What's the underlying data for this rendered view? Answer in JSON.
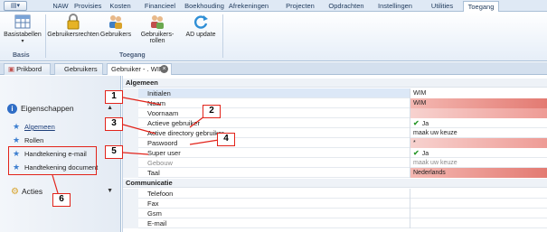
{
  "ribbon_tabs": [
    "NAW",
    "Provisies",
    "Kosten",
    "Financieel",
    "Boekhouding",
    "Afrekeningen",
    "Projecten",
    "Opdrachten",
    "Instellingen",
    "Utilities",
    "Toegang"
  ],
  "ribbon": {
    "basis_button": "Basistabellen",
    "basis_group": "Basis",
    "buttons": [
      "Gebruikersrechten",
      "Gebruikers",
      "Gebruikers-rollen",
      "AD update"
    ],
    "toegang_group": "Toegang"
  },
  "doc_tabs": [
    "Prikbord",
    "Gebruikers",
    "Gebruiker - . WIM"
  ],
  "left": {
    "eigenschappen": "Eigenschappen",
    "items": [
      "Algemeen",
      "Rollen",
      "Handtekening e-mail",
      "Handtekening document"
    ],
    "acties": "Acties"
  },
  "grid": {
    "group_algemeen": "Algemeen",
    "rows": [
      {
        "label": "Initialen",
        "value": "WIM"
      },
      {
        "label": "Naam",
        "value": "WIM"
      },
      {
        "label": "Voornaam",
        "value": ""
      },
      {
        "label": "Actieve gebruiker",
        "value": "Ja"
      },
      {
        "label": "Active directory gebruiker",
        "value": "maak uw keuze"
      },
      {
        "label": "Paswoord",
        "value": "*"
      },
      {
        "label": "Super user",
        "value": "Ja"
      },
      {
        "label": "Gebouw",
        "value": "maak uw keuze"
      },
      {
        "label": "Taal",
        "value": "Nederlands"
      }
    ],
    "group_communicatie": "Communicatie",
    "comm_rows": [
      "Telefoon",
      "Fax",
      "Gsm",
      "E-mail"
    ]
  },
  "callouts": [
    "1",
    "2",
    "3",
    "4",
    "5",
    "6"
  ],
  "colors": {
    "callout_border": "#e2231a",
    "required_field": "#e37a72",
    "accent": "#2f6dc6"
  }
}
